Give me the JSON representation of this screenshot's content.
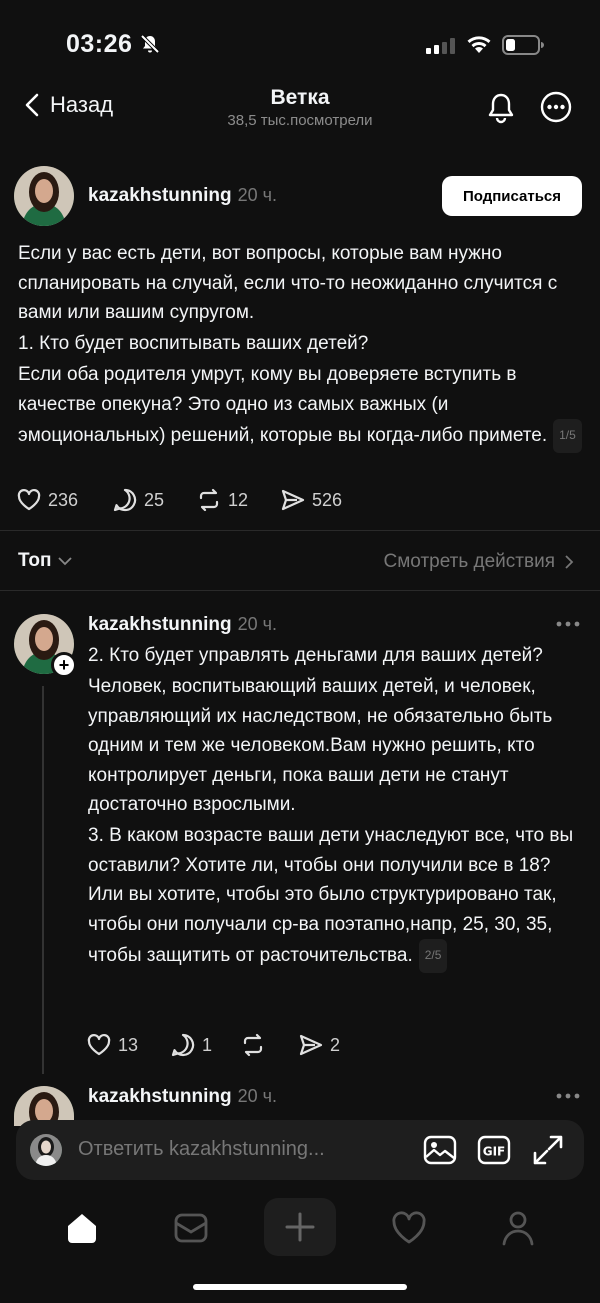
{
  "status_bar": {
    "time": "03:26"
  },
  "header": {
    "back_label": "Назад",
    "title": "Ветка",
    "subtitle": "38,5 тыс.посмотрели"
  },
  "post": {
    "username": "kazakhstunning",
    "time": "20 ч.",
    "follow_label": "Подписаться",
    "paragraphs": [
      "Если у вас есть дети, вот вопросы, которые вам нужно спланировать на случай, если что-то неожиданно случится с вами или вашим супругом.",
      "1. Кто будет воспитывать ваших детей?",
      "Если оба родителя умрут, кому вы доверяете вступить в качестве опекуна? Это одно из самых важных (и эмоциональных) решений, которые вы когда-либо примете."
    ],
    "pager": "1/5",
    "likes": "236",
    "replies": "25",
    "reposts": "12",
    "shares": "526"
  },
  "sort": {
    "label": "Топ",
    "see_actions": "Смотреть действия"
  },
  "reply1": {
    "username": "kazakhstunning",
    "time": "20 ч.",
    "paragraphs": [
      "2. Кто будет управлять деньгами для ваших детей?",
      "Человек, воспитывающий ваших детей, и человек, управляющий их наследством, не обязательно быть одним и тем же человеком.Вам нужно решить, кто контролирует деньги, пока ваши дети не станут достаточно взрослыми.",
      "3. В каком возрасте ваши дети унаследуют все, что вы оставили? Хотите ли, чтобы они получили все в 18? Или вы хотите, чтобы это было структурировано так, чтобы они получали ср-ва поэтапно,напр, 25, 30, 35, чтобы защитить от расточительства."
    ],
    "pager": "2/5",
    "likes": "13",
    "replies": "1",
    "shares": "2"
  },
  "reply2": {
    "username": "kazakhstunning",
    "time": "20 ч."
  },
  "reply_bar": {
    "placeholder": "Ответить kazakhstunning..."
  },
  "colors": {
    "background": "#101010",
    "text": "#f3f5f7",
    "muted": "#777777",
    "surface": "#1e1e1e"
  }
}
